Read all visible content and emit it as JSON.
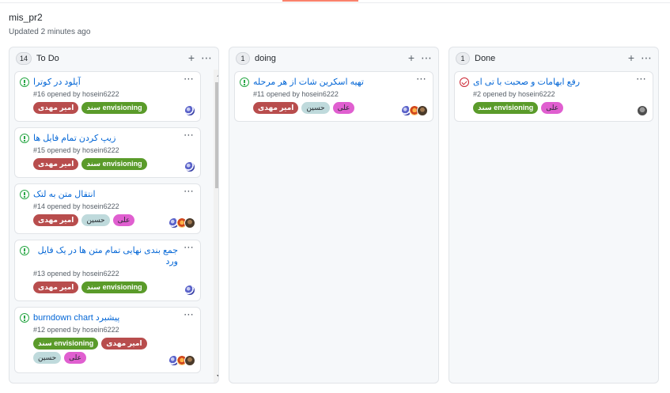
{
  "board": {
    "title": "mis_pr2",
    "updated": "Updated 2 minutes ago"
  },
  "colors": {
    "label_amir": "#b60205",
    "label_sanad": "#5a9b2a",
    "label_hossein": "#bfdadc",
    "label_ali": "#e05fd0",
    "open_issue": "#28a745",
    "closed_issue": "#cb2431",
    "link": "#0366d6"
  },
  "columns": [
    {
      "name": "To Do",
      "count": "14",
      "add_icon": "plus-icon",
      "menu_icon": "kebab-icon",
      "cards": [
        {
          "title": "آپلود در کوترا",
          "meta": "#16 opened by hosein6222",
          "labels": [
            "امیر مهدی",
            "سند envisioning"
          ]
        },
        {
          "title": "زیپ کردن تمام فایل ها",
          "meta": "#15 opened by hosein6222",
          "labels": [
            "امیر مهدی",
            "سند envisioning"
          ]
        },
        {
          "title": "انتقال متن به لتک",
          "meta": "#14 opened by hosein6222",
          "labels": [
            "علی",
            "حسین",
            "امیر مهدی"
          ]
        },
        {
          "title": "جمع بندی نهایی تمام متن ها در یک فایل ورد",
          "meta": "#13 opened by hosein6222",
          "labels": [
            "امیر مهدی",
            "سند envisioning"
          ]
        },
        {
          "title": "پیشبرد burndown chart",
          "meta": "#12 opened by hosein6222",
          "labels": [
            "حسین",
            "امیر مهدی",
            "سند envisioning",
            "علی"
          ]
        }
      ]
    },
    {
      "name": "doing",
      "count": "1",
      "add_icon": "plus-icon",
      "menu_icon": "kebab-icon",
      "cards": [
        {
          "title": "تهیه اسکرین شات از هر مرحله",
          "meta": "#11 opened by hosein6222",
          "labels": [
            "علی",
            "حسین",
            "امیر مهدی"
          ]
        }
      ]
    },
    {
      "name": "Done",
      "count": "1",
      "add_icon": "plus-icon",
      "menu_icon": "kebab-icon",
      "cards": [
        {
          "title": "رفع ابهامات و صحبت با تی ای",
          "meta": "#2 opened by hosein6222",
          "labels": [
            "علی",
            "سند envisioning"
          ]
        }
      ]
    }
  ]
}
